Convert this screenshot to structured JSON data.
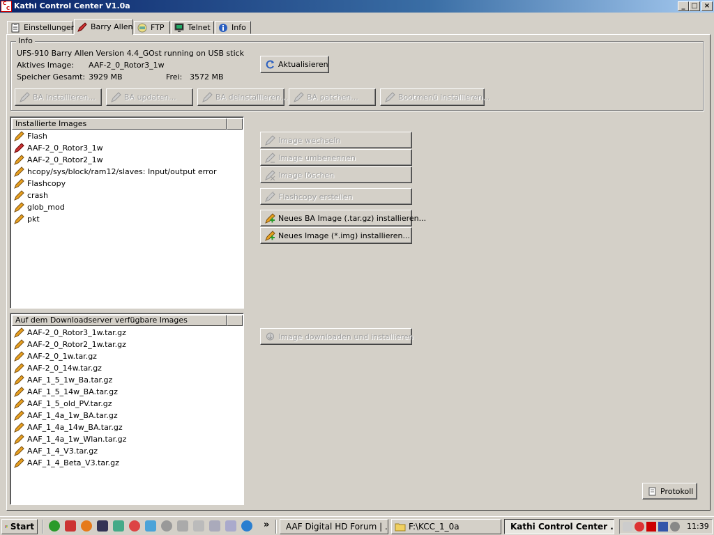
{
  "window": {
    "title": "Kathi Control Center V1.0a",
    "min_label": "_",
    "max_label": "□",
    "close_label": "×"
  },
  "tabs": [
    {
      "label": "Einstellungen",
      "icon": "clipboard-icon"
    },
    {
      "label": "Barry Allen",
      "icon": "pen-icon",
      "active": true
    },
    {
      "label": "FTP",
      "icon": "ftp-icon"
    },
    {
      "label": "Telnet",
      "icon": "monitor-icon"
    },
    {
      "label": "Info",
      "icon": "info-icon"
    }
  ],
  "info": {
    "legend": "Info",
    "version_line": "UFS-910 Barry Allen Version 4.4_GOst running on USB stick",
    "active_image_label": "Aktives Image:",
    "active_image_value": "AAF-2_0_Rotor3_1w",
    "total_storage_label": "Speicher Gesamt:",
    "total_storage_value": "3929 MB",
    "free_label": "Frei:",
    "free_value": "3572 MB",
    "refresh_button": "Aktualisieren",
    "actions": [
      "BA installieren...",
      "BA updaten...",
      "BA deinstallieren...",
      "BA patchen...",
      "Bootmenü installieren..."
    ]
  },
  "installed": {
    "header": "Installierte Images",
    "items": [
      "Flash",
      "AAF-2_0_Rotor3_1w",
      "AAF-2_0_Rotor2_1w",
      "hcopy/sys/block/ram12/slaves: Input/output error",
      "Flashcopy",
      "crash",
      "glob_mod",
      "pkt"
    ],
    "active_index": 1
  },
  "image_actions": {
    "switch": "Image wechseln",
    "rename": "Image umbenennen",
    "delete": "Image löschen",
    "flashcopy": "Flashcopy erstellen",
    "install_ba": "Neues BA Image (.tar.gz) installieren...",
    "install_img": "Neues Image (*.img) installieren..."
  },
  "available": {
    "header": "Auf dem Downloadserver verfügbare Images",
    "items": [
      "AAF-2_0_Rotor3_1w.tar.gz",
      "AAF-2_0_Rotor2_1w.tar.gz",
      "AAF-2_0_1w.tar.gz",
      "AAF-2_0_14w.tar.gz",
      "AAF_1_5_1w_Ba.tar.gz",
      "AAF_1_5_14w_BA.tar.gz",
      "AAF_1_5_old_PV.tar.gz",
      "AAF_1_4a_1w_BA.tar.gz",
      "AAF_1_4a_14w_BA.tar.gz",
      "AAF_1_4a_1w_Wlan.tar.gz",
      "AAF_1_4_V3.tar.gz",
      "AAF_1_4_Beta_V3.tar.gz"
    ],
    "download_button": "Image downloaden und installieren"
  },
  "protocol_button": "Protokoll",
  "taskbar": {
    "start": "Start",
    "chevron": "»",
    "tasks": [
      {
        "label": "AAF Digital HD Forum | ...",
        "icon": "firefox-icon"
      },
      {
        "label": "F:\\KCC_1_0a",
        "icon": "folder-icon"
      },
      {
        "label": "Kathi Control Center ...",
        "icon": "kcc-icon",
        "active": true
      }
    ],
    "clock": "11:39"
  },
  "colors": {
    "title_start": "#0a246a",
    "title_end": "#a6caf0",
    "face": "#d4d0c8",
    "active_pen": "#cc3333",
    "pen": "#e8a020"
  }
}
